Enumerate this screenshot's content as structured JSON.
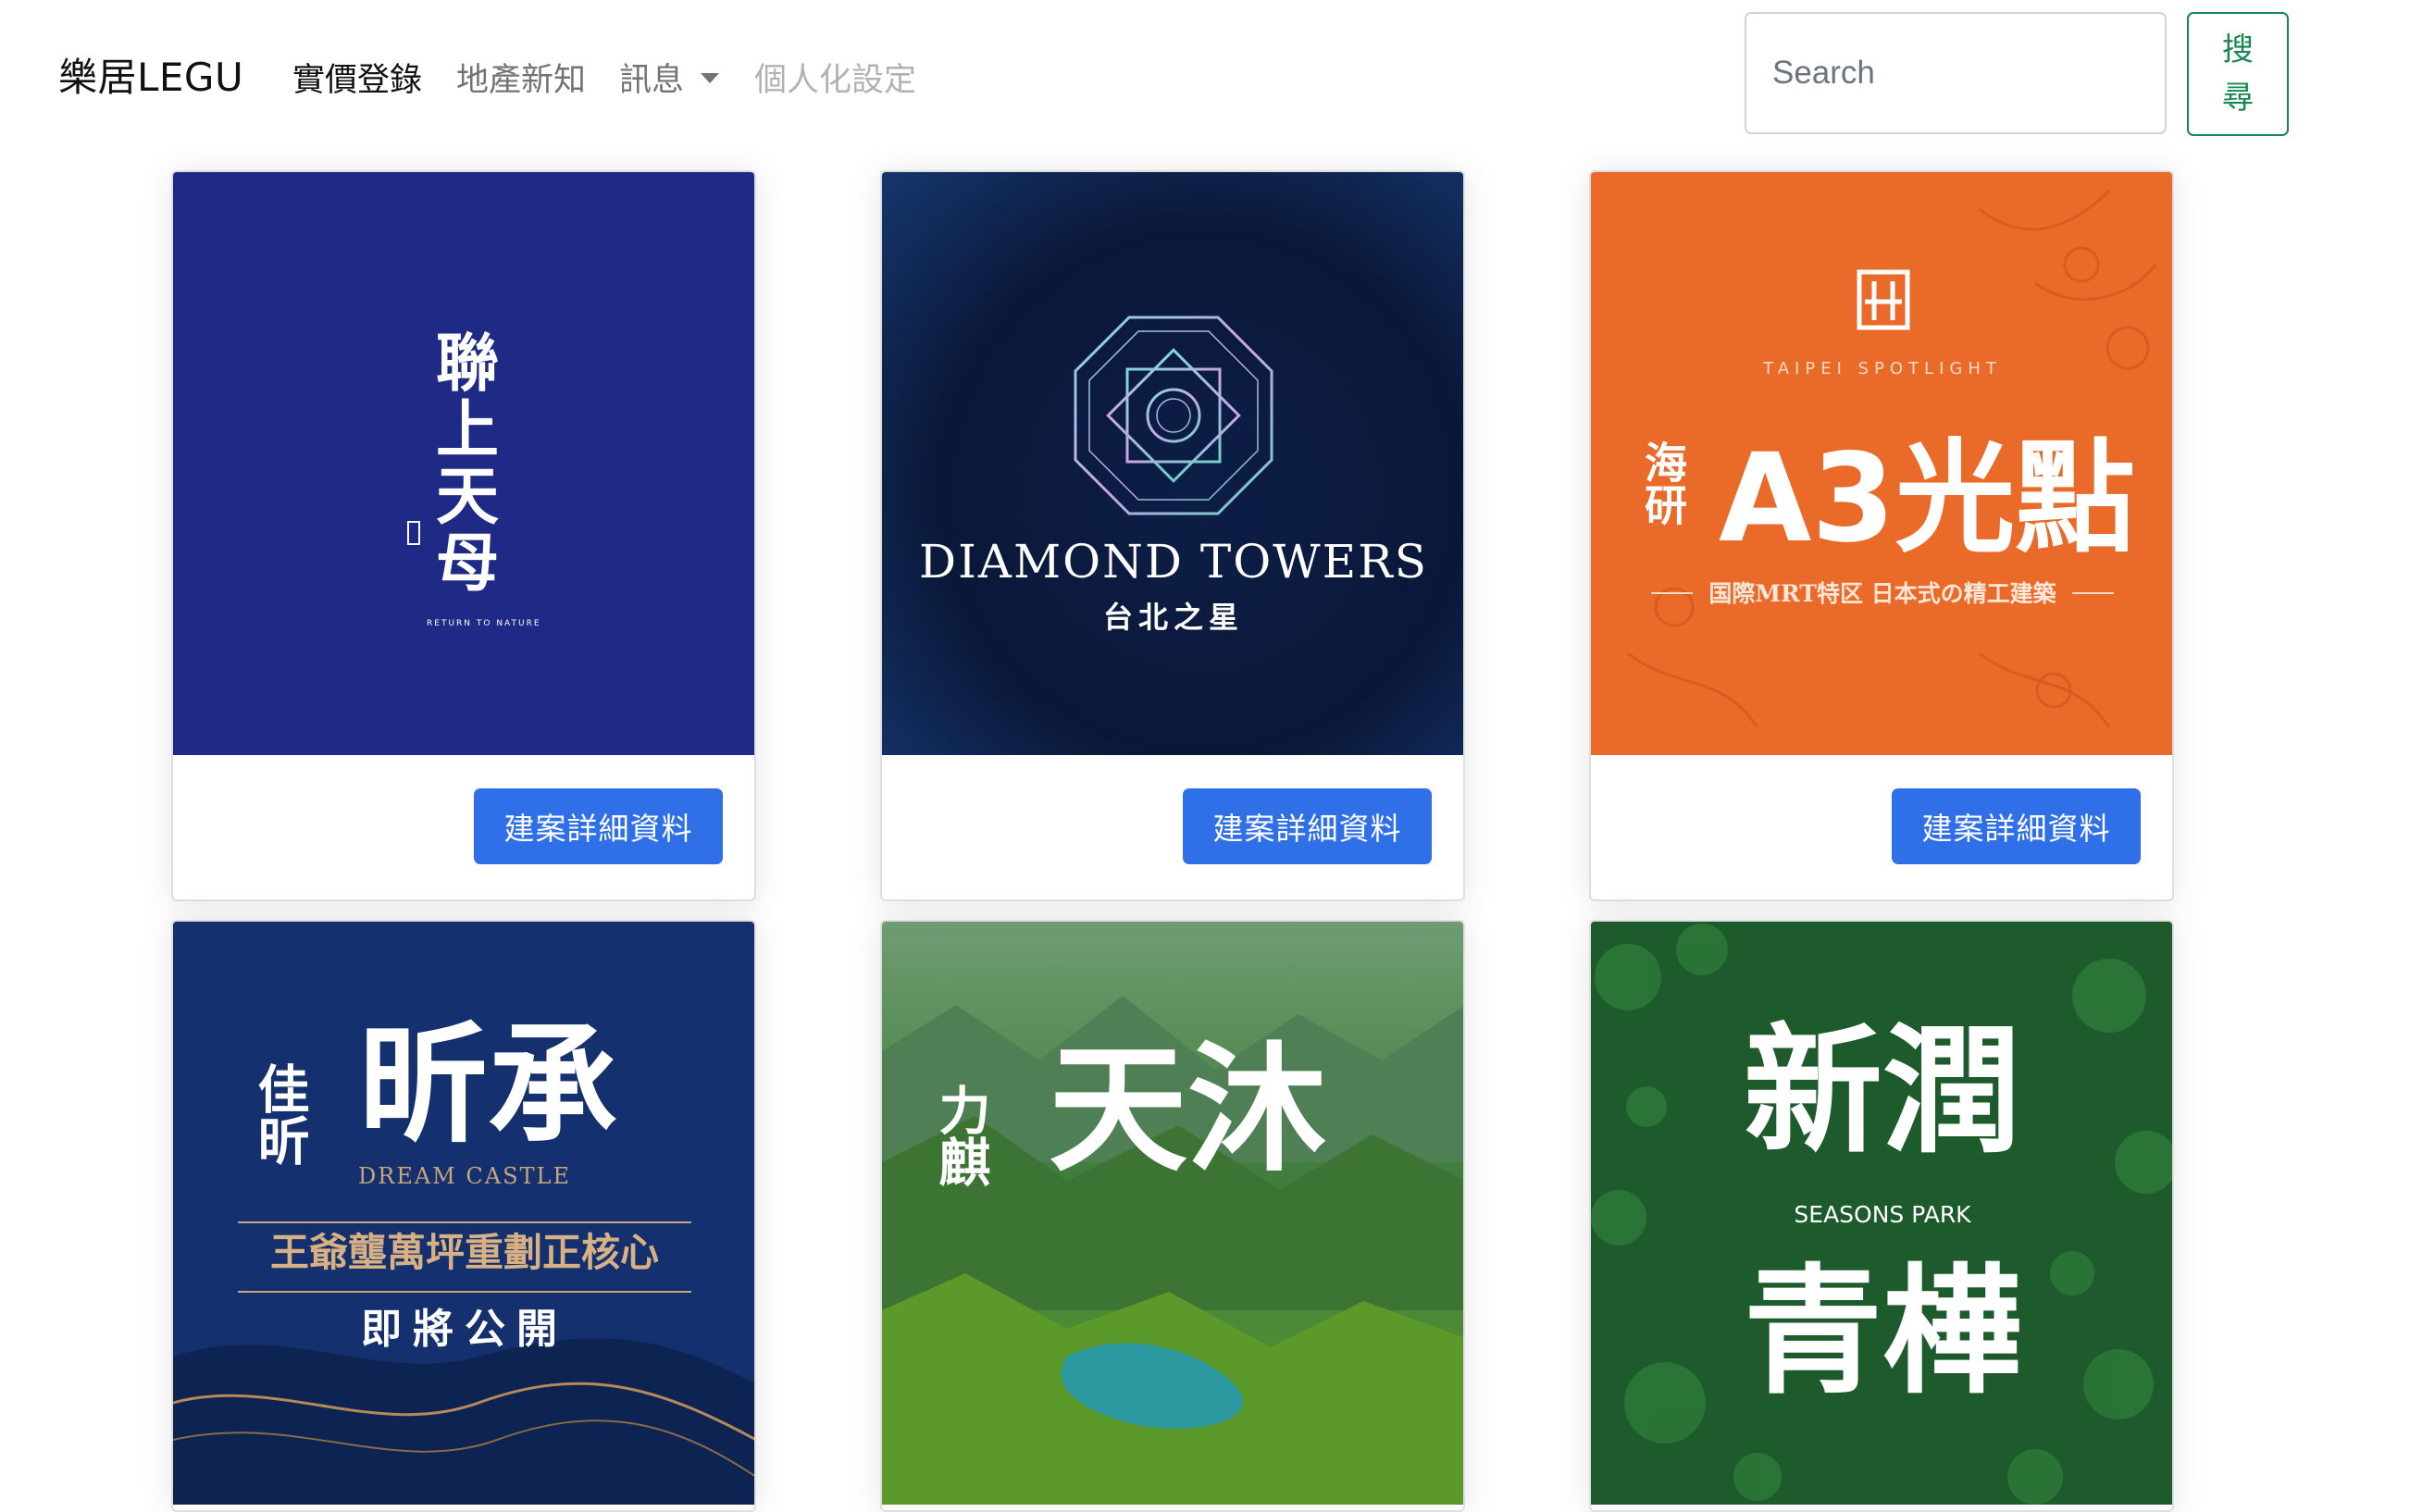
{
  "navbar": {
    "brand": "樂居LEGU",
    "links": [
      "實價登錄",
      "地產新知",
      "訊息",
      "個人化設定"
    ],
    "search_placeholder": "Search",
    "search_button": "搜尋"
  },
  "cards": [
    {
      "lines": [
        "聯",
        "上",
        "天",
        "母"
      ],
      "small_caption": "RETURN TO NATURE",
      "button": "建案詳細資料",
      "bg": "#1f2a86"
    },
    {
      "title": "DIAMOND TOWERS",
      "subtitle": "台北之星",
      "button": "建案詳細資料",
      "bg": "#0c1a38"
    },
    {
      "eyebrow": "TAIPEI SPOTLIGHT",
      "side": "海研",
      "title": "A3光點",
      "subtitle": "国際MRT特区 日本式の精工建築",
      "button": "建案詳細資料",
      "bg": "#ea6a2a"
    },
    {
      "side": "佳昕",
      "title": "昕承",
      "english": "DREAM CASTLE",
      "line1": "王爺壟萬坪重劃正核心",
      "line2": "即將公開",
      "bg": "#14306e"
    },
    {
      "side": "力麒",
      "title": "天沐",
      "bg": "#3f7d3b"
    },
    {
      "title_top": "新潤",
      "english": "SEASONS PARK",
      "title_bottom": "青樺",
      "bg": "#1d5a2c"
    }
  ]
}
